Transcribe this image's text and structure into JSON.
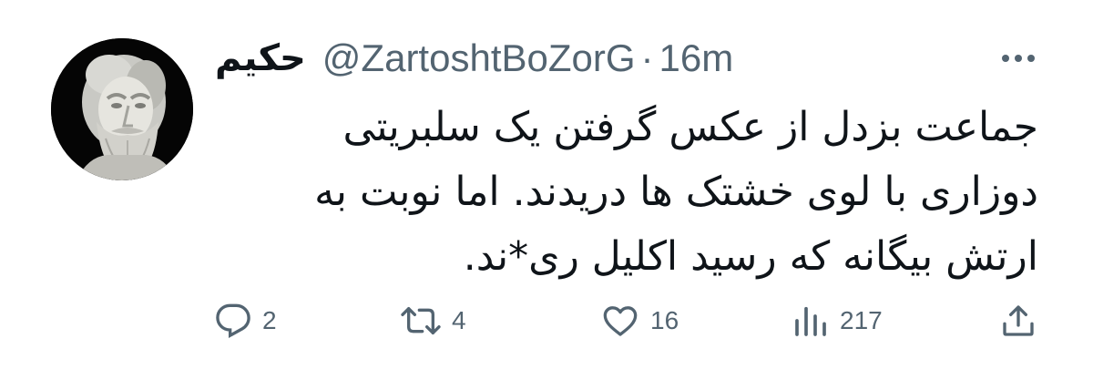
{
  "tweet": {
    "display_name": "حکیم",
    "handle": "@ZartoshtBoZorG",
    "separator": "·",
    "time": "16m",
    "lines": [
      "جماعت بزدل از عکس گرفتن یک سلبریتی",
      "دوزاری با لوی خشتک ها دریدند. اما نوبت به",
      "ارتش بیگانه که رسید اکلیل ری*ند."
    ]
  },
  "actions": {
    "replies": "2",
    "retweets": "4",
    "likes": "16",
    "views": "217"
  },
  "icons": {
    "more": "more-horizontal-icon",
    "reply": "reply-icon",
    "retweet": "retweet-icon",
    "like": "heart-icon",
    "views": "views-bar-chart-icon",
    "share": "share-upload-icon"
  },
  "colors": {
    "text": "#0f1419",
    "secondary": "#536471",
    "background": "#ffffff"
  }
}
